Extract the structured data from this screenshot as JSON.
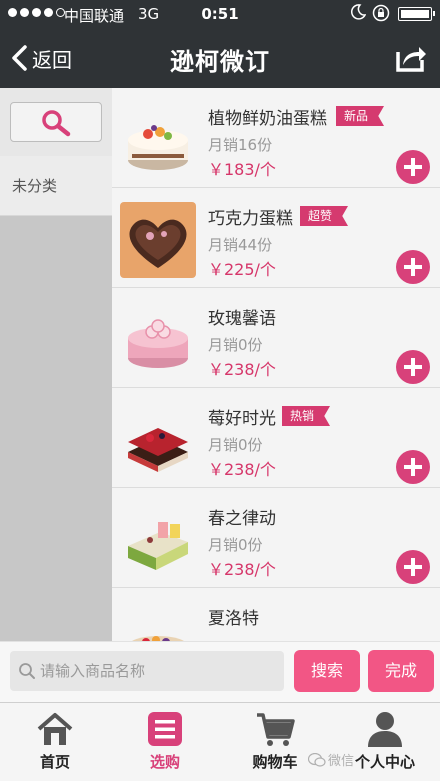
{
  "status_bar": {
    "carrier": "中国联通",
    "network": "3G",
    "time": "0:51",
    "signal_bars": 4,
    "signal_total": 5,
    "battery_level": 1.0
  },
  "header": {
    "back_label": "返回",
    "title": "逊柯微订",
    "share_icon": "share-icon"
  },
  "sidebar": {
    "search_icon": "search-icon",
    "categories": [
      "未分类"
    ]
  },
  "products": [
    {
      "name": "植物鲜奶油蛋糕",
      "tag": "新品",
      "sales": "月销16份",
      "price": "￥183/个"
    },
    {
      "name": "巧克力蛋糕",
      "tag": "超赞",
      "sales": "月销44份",
      "price": "￥225/个"
    },
    {
      "name": "玫瑰馨语",
      "tag": "",
      "sales": "月销0份",
      "price": "￥238/个"
    },
    {
      "name": "莓好时光",
      "tag": "热销",
      "sales": "月销0份",
      "price": "￥238/个"
    },
    {
      "name": "春之律动",
      "tag": "",
      "sales": "月销0份",
      "price": "￥238/个"
    },
    {
      "name": "夏洛特",
      "tag": "",
      "sales": "",
      "price": ""
    }
  ],
  "search_bar": {
    "placeholder": "请输入商品名称",
    "value": "",
    "search_label": "搜索",
    "done_label": "完成"
  },
  "tabs": [
    {
      "label": "首页",
      "icon": "home-icon",
      "active": false
    },
    {
      "label": "选购",
      "icon": "menu-list-icon",
      "active": true
    },
    {
      "label": "购物车",
      "icon": "cart-icon",
      "active": false
    },
    {
      "label": "个人中心",
      "icon": "user-icon",
      "active": false
    }
  ],
  "watermark": "微信",
  "colors": {
    "header_bg": "#2f3336",
    "accent": "#d8417a",
    "button": "#f25685",
    "sidebar_bg": "#c7c7c7"
  }
}
